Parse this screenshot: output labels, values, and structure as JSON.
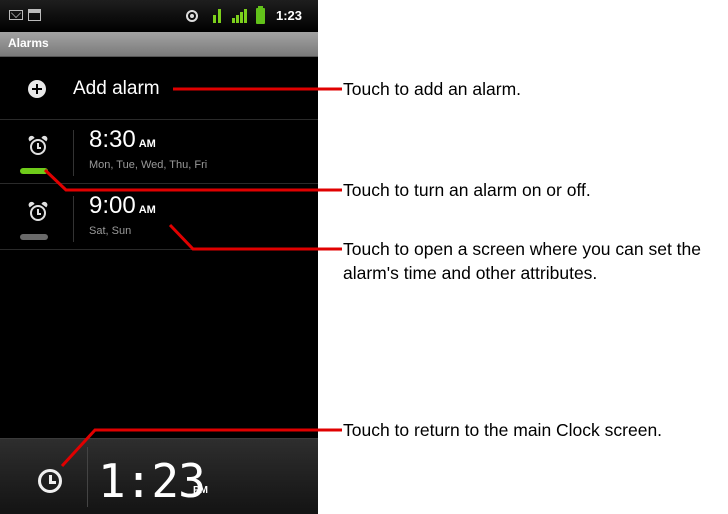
{
  "status_bar": {
    "time": "1:23",
    "icons": [
      "gmail-icon",
      "calendar-icon",
      "gps-icon",
      "data-icon",
      "signal-icon",
      "battery-icon"
    ]
  },
  "app": {
    "title": "Alarms"
  },
  "add_alarm": {
    "label": "Add alarm",
    "icon": "plus-icon"
  },
  "alarms": [
    {
      "time": "8:30",
      "ampm": "AM",
      "days": "Mon, Tue, Wed, Thu, Fri",
      "enabled": true,
      "icon": "alarm-clock-icon"
    },
    {
      "time": "9:00",
      "ampm": "AM",
      "days": "Sat, Sun",
      "enabled": false,
      "icon": "alarm-clock-icon"
    }
  ],
  "clock_bar": {
    "time": "1:23",
    "ampm": "PM",
    "icon": "clock-icon"
  },
  "callouts": [
    "Touch to add an alarm.",
    "Touch to turn an alarm on or off.",
    "Touch to open a screen where you can set the alarm's time and other attributes.",
    "Touch to return to the main Clock screen."
  ],
  "colors": {
    "toggle_on": "#6fcb1a",
    "toggle_off": "#6a6a6a",
    "leader_line": "#e00000"
  }
}
